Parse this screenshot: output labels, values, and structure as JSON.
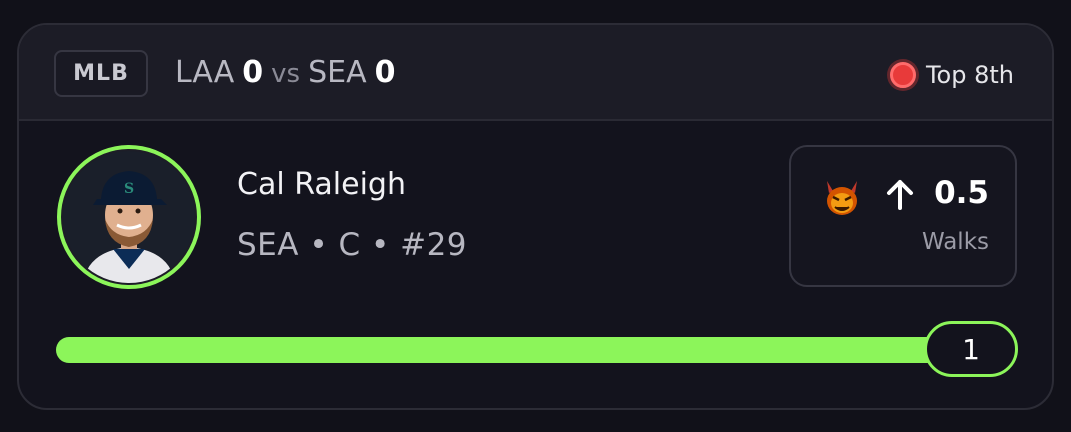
{
  "header": {
    "league": "MLB",
    "away_team": "LAA",
    "away_score": "0",
    "vs": "vs",
    "home_team": "SEA",
    "home_score": "0",
    "status": "Top 8th",
    "status_icon": "live-dot-icon",
    "status_color": "#e83a3a"
  },
  "player": {
    "name": "Cal Raleigh",
    "meta": "SEA • C • #29",
    "ring_color": "#8cf55a"
  },
  "prop": {
    "icon": "devil-icon",
    "direction_icon": "arrow-up-icon",
    "line": "0.5",
    "stat": "Walks"
  },
  "progress": {
    "current": "1",
    "fraction": 1.0,
    "color": "#8cf55a"
  }
}
